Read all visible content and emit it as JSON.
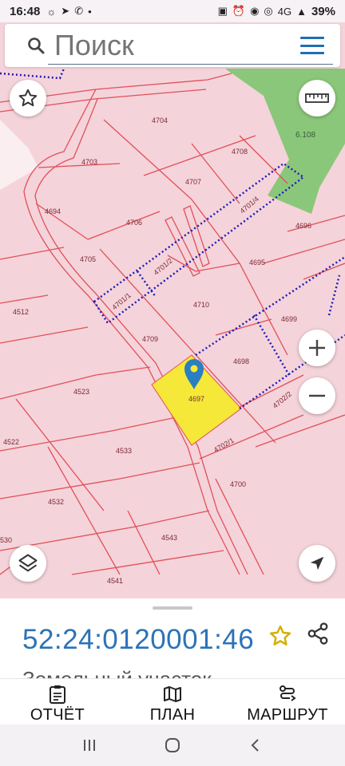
{
  "status_bar": {
    "time": "16:48",
    "network": "4G",
    "battery": "39%"
  },
  "search": {
    "placeholder": "Поиск"
  },
  "map": {
    "parcel_labels": [
      "4704",
      "4703",
      "4708",
      "4707",
      "4694",
      "4706",
      "4696",
      "4705",
      "4701/4",
      "4701/2",
      "4695",
      "4512",
      "4701/1",
      "4710",
      "4699",
      "4709",
      "4698",
      "4523",
      "4697",
      "4702/2",
      "4522",
      "4533",
      "4702/1",
      "4700",
      "4532",
      "4543",
      "530",
      "4541",
      "6.108"
    ],
    "selected_parcel": "4697",
    "colors": {
      "background": "#f5d3da",
      "parcel_border": "#e0505a",
      "selected_fill": "#f5e838",
      "green_area": "#8bc77a",
      "route_dotted": "#1d1db8",
      "marker": "#2a7fc0"
    }
  },
  "buttons": {
    "favorite_icon": "star-outline-icon",
    "ruler_icon": "ruler-icon",
    "zoom_in_icon": "plus-icon",
    "zoom_out_icon": "minus-icon",
    "layers_icon": "layers-icon",
    "location_icon": "navigation-arrow-icon"
  },
  "sheet": {
    "cadastral_number": "52:24:0120001:46",
    "subtitle": "Земельный участок"
  },
  "actions": [
    {
      "label": "ОТЧЁТ",
      "icon": "report-icon"
    },
    {
      "label": "ПЛАН",
      "icon": "map-plan-icon"
    },
    {
      "label": "МАРШРУТ",
      "icon": "route-icon"
    }
  ]
}
